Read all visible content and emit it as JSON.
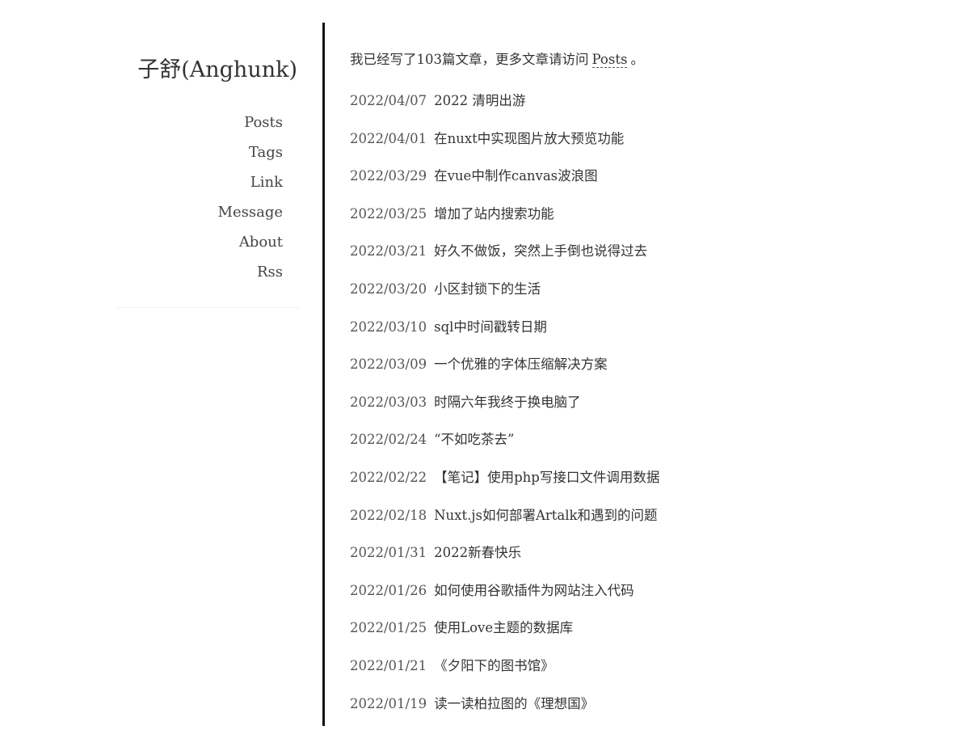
{
  "site": {
    "title": "子舒(Anghunk)"
  },
  "nav": {
    "items": [
      {
        "label": "Posts"
      },
      {
        "label": "Tags"
      },
      {
        "label": "Link"
      },
      {
        "label": "Message"
      },
      {
        "label": "About"
      },
      {
        "label": "Rss"
      }
    ]
  },
  "intro": {
    "prefix": "我已经写了103篇文章，更多文章请访问",
    "link": "Posts",
    "suffix": "。"
  },
  "posts": [
    {
      "date": "2022/04/07",
      "title": "2022 清明出游"
    },
    {
      "date": "2022/04/01",
      "title": "在nuxt中实现图片放大预览功能"
    },
    {
      "date": "2022/03/29",
      "title": "在vue中制作canvas波浪图"
    },
    {
      "date": "2022/03/25",
      "title": "增加了站内搜索功能"
    },
    {
      "date": "2022/03/21",
      "title": "好久不做饭，突然上手倒也说得过去"
    },
    {
      "date": "2022/03/20",
      "title": "小区封锁下的生活"
    },
    {
      "date": "2022/03/10",
      "title": "sql中时间戳转日期"
    },
    {
      "date": "2022/03/09",
      "title": "一个优雅的字体压缩解决方案"
    },
    {
      "date": "2022/03/03",
      "title": "时隔六年我终于换电脑了"
    },
    {
      "date": "2022/02/24",
      "title": "“不如吃茶去”"
    },
    {
      "date": "2022/02/22",
      "title": "【笔记】使用php写接口文件调用数据"
    },
    {
      "date": "2022/02/18",
      "title": "Nuxt.js如何部署Artalk和遇到的问题"
    },
    {
      "date": "2022/01/31",
      "title": "2022新春快乐"
    },
    {
      "date": "2022/01/26",
      "title": "如何使用谷歌插件为网站注入代码"
    },
    {
      "date": "2022/01/25",
      "title": "使用Love主题的数据库"
    },
    {
      "date": "2022/01/21",
      "title": "《夕阳下的图书馆》"
    },
    {
      "date": "2022/01/19",
      "title": "读一读柏拉图的《理想国》"
    }
  ]
}
